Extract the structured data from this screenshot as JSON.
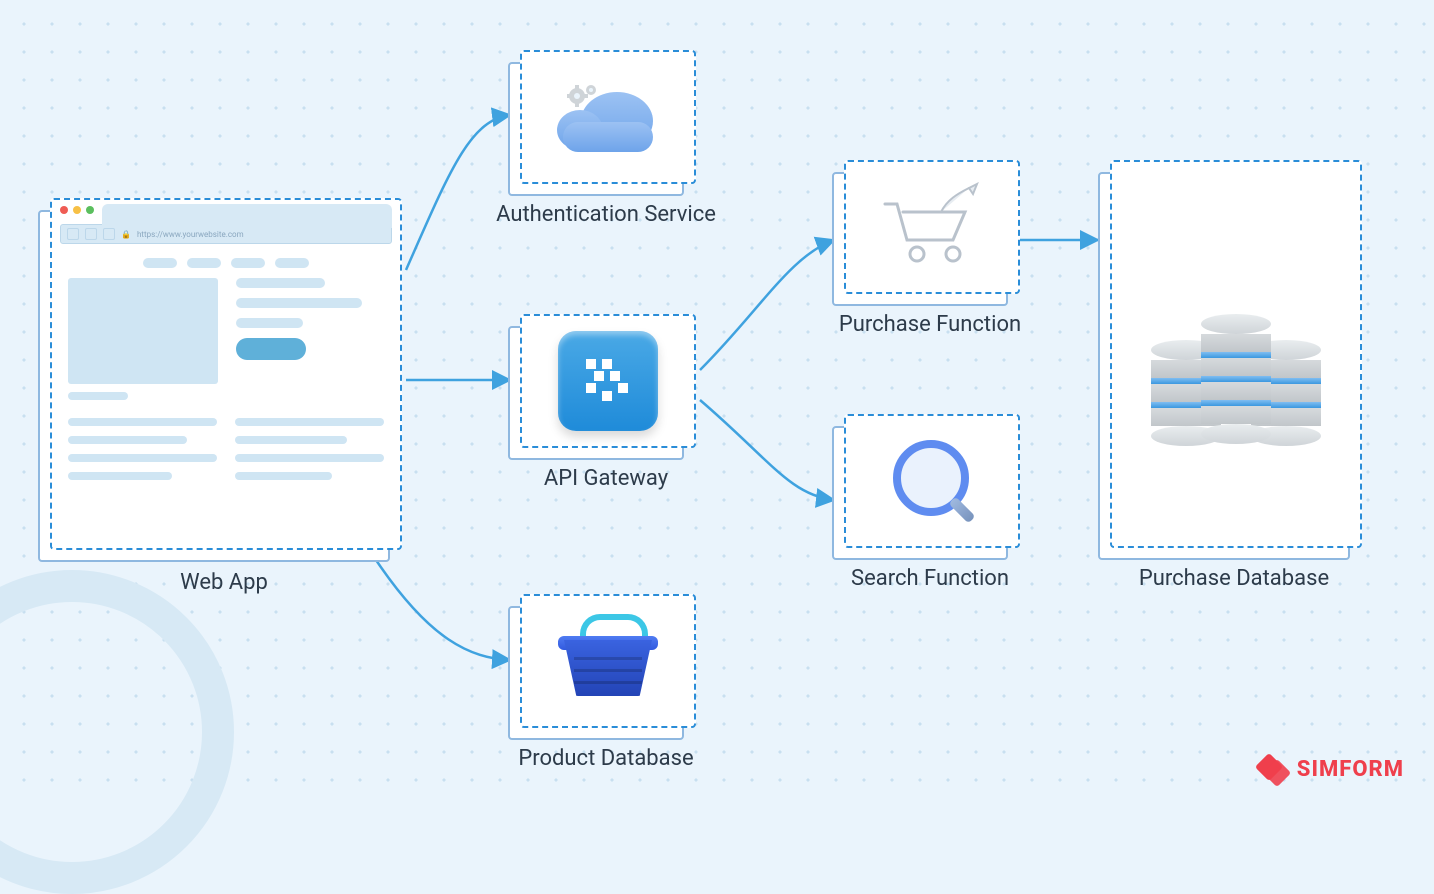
{
  "diagram": {
    "nodes": {
      "webapp": {
        "label": "Web App",
        "url": "https://www.yourwebsite.com"
      },
      "auth": {
        "label": "Authentication Service"
      },
      "api": {
        "label": "API Gateway"
      },
      "product": {
        "label": "Product Database"
      },
      "purchase": {
        "label": "Purchase Function"
      },
      "search": {
        "label": "Search Function"
      },
      "purchdb": {
        "label": "Purchase Database"
      }
    },
    "edges": [
      {
        "from": "webapp",
        "to": "auth"
      },
      {
        "from": "webapp",
        "to": "api"
      },
      {
        "from": "webapp",
        "to": "product"
      },
      {
        "from": "api",
        "to": "purchase"
      },
      {
        "from": "api",
        "to": "search"
      },
      {
        "from": "purchase",
        "to": "purchdb"
      }
    ]
  },
  "brand": "SIMFORM"
}
